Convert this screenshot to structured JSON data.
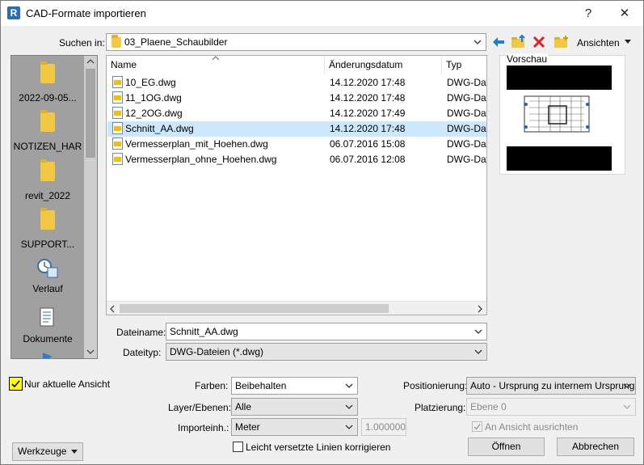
{
  "window": {
    "title": "CAD-Formate importieren",
    "help_glyph": "?",
    "close_glyph": "✕"
  },
  "toolbar": {
    "search_label": "Suchen in:",
    "search_value": "03_Plaene_Schaubilder",
    "views_label": "Ansichten"
  },
  "places": [
    {
      "label": "2022-09-05...",
      "icon": "folder-icon"
    },
    {
      "label": "NOTIZEN_HAR",
      "icon": "folder-icon"
    },
    {
      "label": "revit_2022",
      "icon": "folder-icon"
    },
    {
      "label": "SUPPORT...",
      "icon": "folder-icon"
    },
    {
      "label": "Verlauf",
      "icon": "history-icon"
    },
    {
      "label": "Dokumente",
      "icon": "documents-icon"
    }
  ],
  "file_list": {
    "columns": [
      "Name",
      "Änderungsdatum",
      "Typ"
    ],
    "rows": [
      {
        "name": "10_EG.dwg",
        "date": "14.12.2020 17:48",
        "type": "DWG-Dat",
        "selected": false
      },
      {
        "name": "11_1OG.dwg",
        "date": "14.12.2020 17:48",
        "type": "DWG-Dat",
        "selected": false
      },
      {
        "name": "12_2OG.dwg",
        "date": "14.12.2020 17:49",
        "type": "DWG-Dat",
        "selected": false
      },
      {
        "name": "Schnitt_AA.dwg",
        "date": "14.12.2020 17:48",
        "type": "DWG-Dat",
        "selected": true
      },
      {
        "name": "Vermesserplan_mit_Hoehen.dwg",
        "date": "06.07.2016 15:08",
        "type": "DWG-Dat",
        "selected": false
      },
      {
        "name": "Vermesserplan_ohne_Hoehen.dwg",
        "date": "06.07.2016 12:08",
        "type": "DWG-Dat",
        "selected": false
      }
    ]
  },
  "preview": {
    "label": "Vorschau"
  },
  "filename": {
    "label": "Dateiname:",
    "value": "Schnitt_AA.dwg"
  },
  "filetype": {
    "label": "Dateityp:",
    "value": "DWG-Dateien  (*.dwg)"
  },
  "options": {
    "current_view_label": "Nur aktuelle Ansicht",
    "colors_label": "Farben:",
    "colors_value": "Beibehalten",
    "layers_label": "Layer/Ebenen:",
    "layers_value": "Alle",
    "units_label": "Importeinh.:",
    "units_value": "Meter",
    "units_factor": "1.000000",
    "correct_lines_label": "Leicht versetzte Linien korrigieren",
    "positioning_label": "Positionierung:",
    "positioning_value": "Auto - Ursprung zu internem Ursprung",
    "placement_label": "Platzierung:",
    "placement_value": "Ebene 0",
    "orient_label": "An Ansicht ausrichten"
  },
  "buttons": {
    "tools": "Werkzeuge",
    "open": "Öffnen",
    "cancel": "Abbrechen"
  },
  "colors": {
    "selection": "#cce8ff",
    "places_bg": "#a0a0a0",
    "highlight": "#ffff00"
  }
}
